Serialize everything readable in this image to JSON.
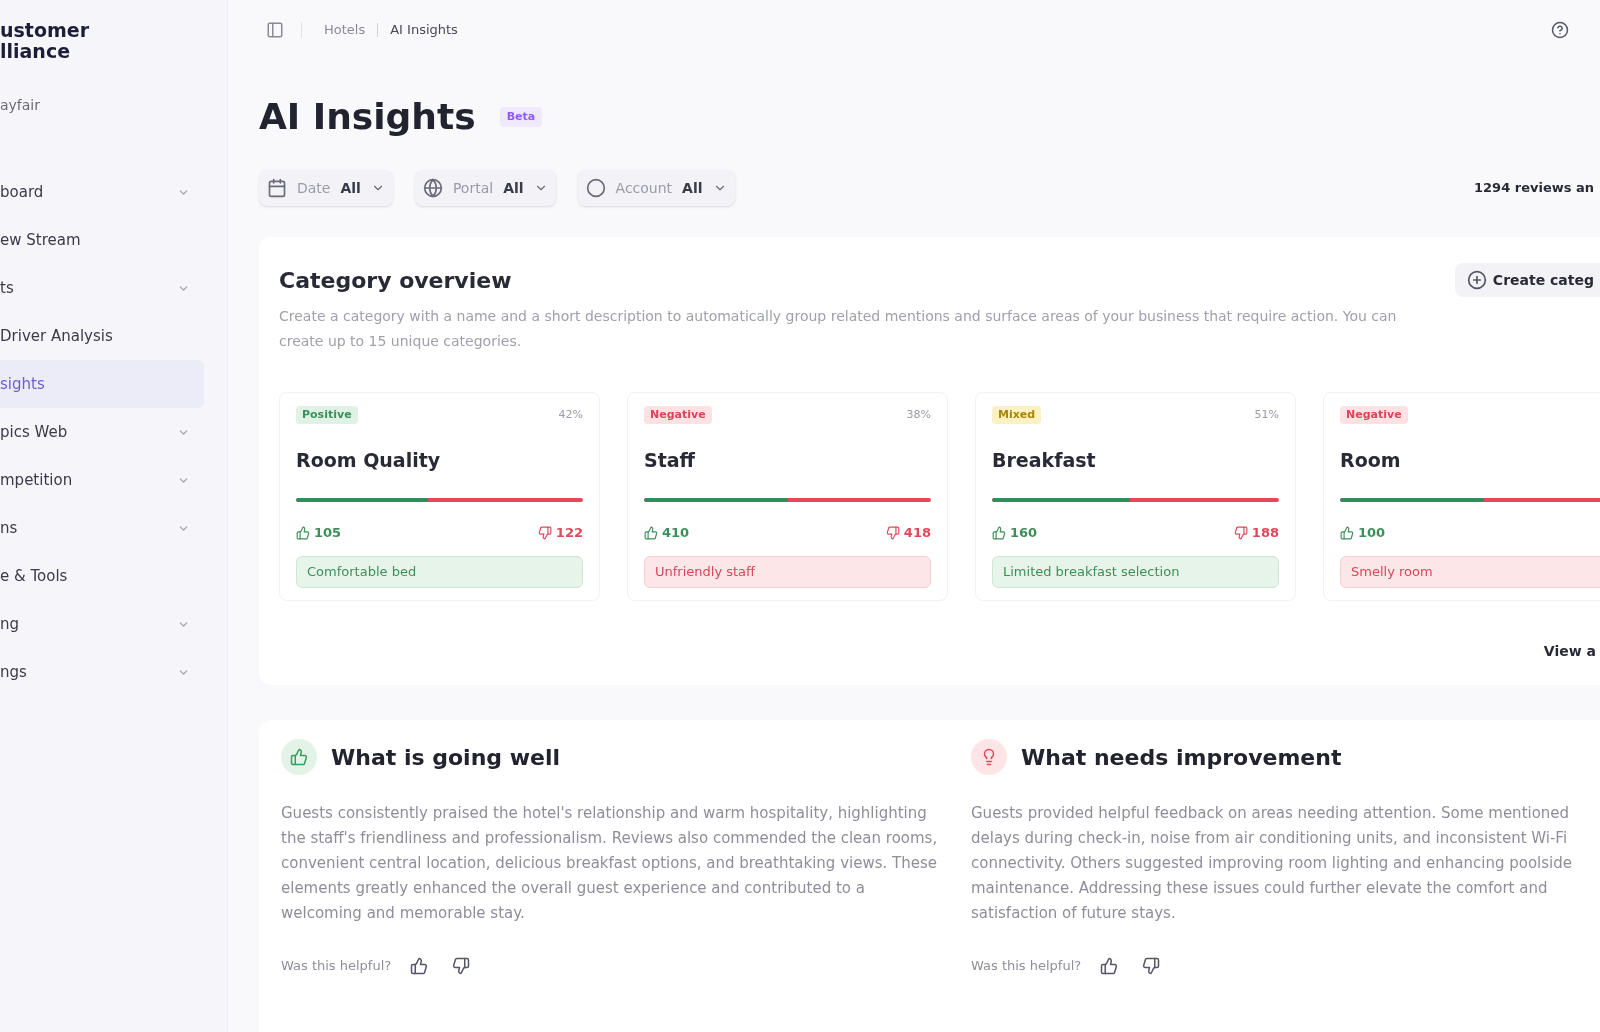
{
  "sidebar": {
    "brand": [
      "ustomer",
      "lliance"
    ],
    "subtitle": "ayfair",
    "items": [
      {
        "label": "board",
        "selected": false,
        "expandable": true
      },
      {
        "label": "ew Stream",
        "selected": false,
        "expandable": false
      },
      {
        "label": "ts",
        "selected": false,
        "expandable": true
      },
      {
        "label": "Driver Analysis",
        "selected": false,
        "expandable": false
      },
      {
        "label": "sights",
        "selected": true,
        "expandable": false
      },
      {
        "label": "pics Web",
        "selected": false,
        "expandable": true
      },
      {
        "label": "mpetition",
        "selected": false,
        "expandable": true
      },
      {
        "label": "ns",
        "selected": false,
        "expandable": true
      },
      {
        "label": "e & Tools",
        "selected": false,
        "expandable": false
      },
      {
        "label": "ng",
        "selected": false,
        "expandable": true
      },
      {
        "label": "ngs",
        "selected": false,
        "expandable": true
      }
    ]
  },
  "header": {
    "breadcrumb": [
      "Hotels",
      "AI Insights"
    ]
  },
  "page": {
    "title": "AI Insights",
    "badge": "Beta"
  },
  "filters": [
    {
      "kind": "date",
      "label": "Date",
      "value": "All"
    },
    {
      "kind": "portal",
      "label": "Portal",
      "value": "All"
    },
    {
      "kind": "account",
      "label": "Account",
      "value": "All"
    }
  ],
  "review_count": "1294 reviews an",
  "category_overview": {
    "title": "Category overview",
    "description": "Create a category with a name and a short description to automatically group related mentions and surface areas of your business that require action. You can create up to 15 unique categories.",
    "create_button": "Create categ",
    "view_all": "View a",
    "categories": [
      {
        "kind": "positive",
        "badge": "Positive",
        "stat": "42%",
        "title": "Room Quality",
        "level": 0.46,
        "up": "105",
        "down": "122",
        "chip": {
          "text": "Comfortable bed",
          "kind": "positive"
        }
      },
      {
        "kind": "negative",
        "badge": "Negative",
        "stat": "38%",
        "title": "Staff",
        "level": 0.5,
        "up": "410",
        "down": "418",
        "chip": {
          "text": "Unfriendly staff",
          "kind": "negative"
        }
      },
      {
        "kind": "mixed",
        "badge": "Mixed",
        "stat": "51%",
        "title": "Breakfast",
        "level": 0.48,
        "up": "160",
        "down": "188",
        "chip": {
          "text": "Limited breakfast selection",
          "kind": "positive"
        }
      },
      {
        "kind": "negative",
        "badge": "Negative",
        "title": "Room",
        "level": 0.5,
        "up": "100",
        "chip": {
          "text": "Smelly room",
          "kind": "negative"
        }
      }
    ]
  },
  "insights": [
    {
      "kind": "positive",
      "title": "What is going well",
      "text": "Guests consistently praised the hotel's relationship and warm hospitality, highlighting the staff's friendliness and professionalism. Reviews also commended the clean rooms, convenient central location, delicious breakfast options, and breathtaking views. These elements greatly enhanced the overall guest experience and contributed to a welcoming and memorable stay.",
      "feedback_prompt": "Was this helpful?"
    },
    {
      "kind": "negative",
      "title": "What needs improvement",
      "text": "Guests provided helpful feedback on areas needing attention. Some mentioned delays during check-in, noise from air conditioning units, and inconsistent Wi-Fi connectivity. Others suggested improving room lighting and enhancing poolside maintenance. Addressing these issues could further elevate the comfort and satisfaction of future stays.",
      "feedback_prompt": "Was this helpful?"
    }
  ]
}
